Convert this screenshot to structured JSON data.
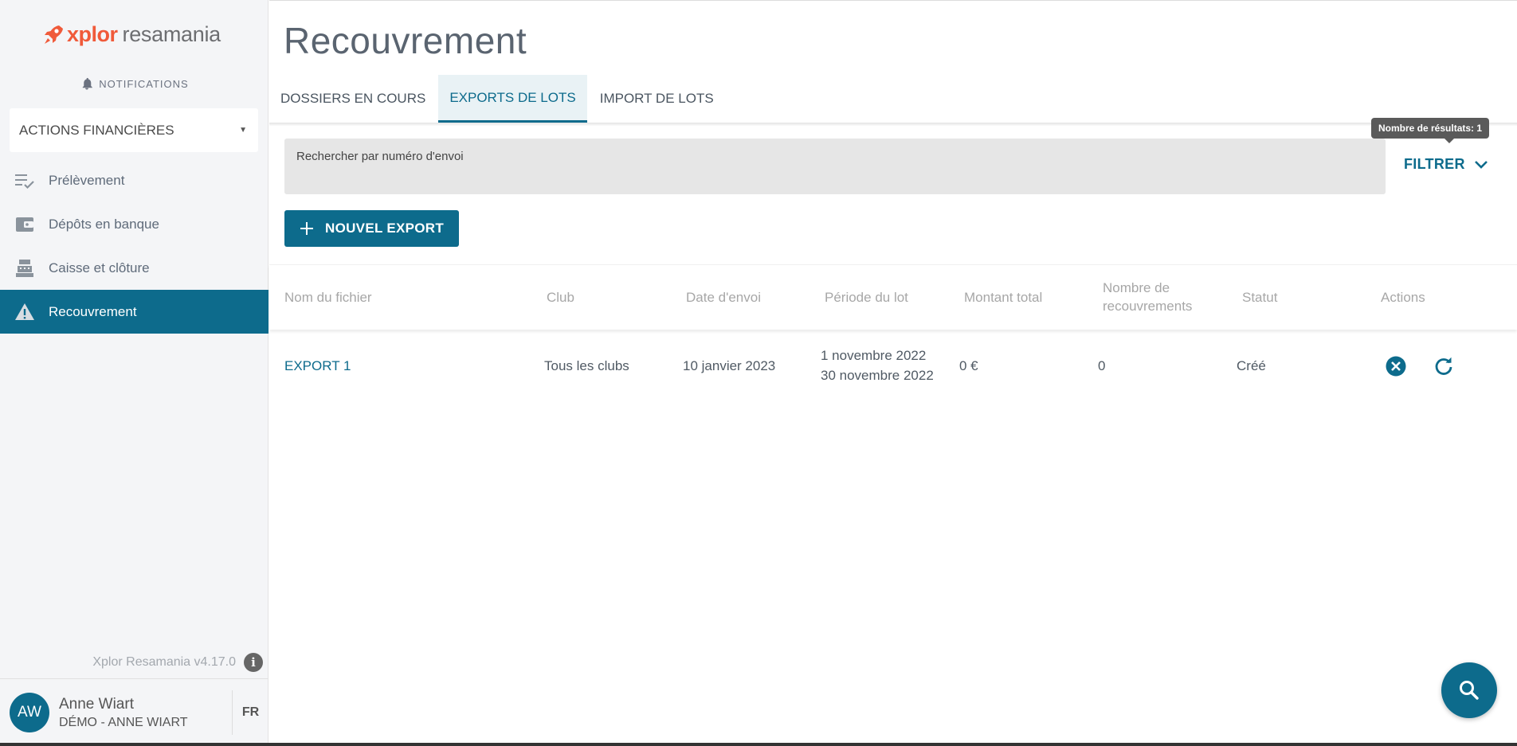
{
  "brand": {
    "part1": "xplor",
    "part2": "resamania",
    "accent": "#f05a3a",
    "primary": "#0d6b8c"
  },
  "sidebar": {
    "notifications": "NOTIFICATIONS",
    "section_select": "ACTIONS FINANCIÈRES",
    "items": [
      {
        "label": "Prélèvement",
        "icon": "checklist-icon"
      },
      {
        "label": "Dépôts en banque",
        "icon": "wallet-icon"
      },
      {
        "label": "Caisse et clôture",
        "icon": "cash-register-icon"
      },
      {
        "label": "Recouvrement",
        "icon": "warning-icon",
        "active": true
      }
    ],
    "version": "Xplor Resamania v4.17.0",
    "user": {
      "initials": "AW",
      "name": "Anne Wiart",
      "org": "DÉMO - ANNE WIART",
      "lang": "FR"
    }
  },
  "main": {
    "title": "Recouvrement",
    "tabs": [
      {
        "label": "DOSSIERS EN COURS"
      },
      {
        "label": "EXPORTS DE LOTS",
        "active": true
      },
      {
        "label": "IMPORT DE LOTS"
      }
    ],
    "search_placeholder": "Rechercher par numéro d'envoi",
    "results_tooltip": "Nombre de résultats: 1",
    "filter_label": "FILTRER",
    "new_export_label": "NOUVEL EXPORT",
    "table": {
      "headers": [
        "Nom du fichier",
        "Club",
        "Date d'envoi",
        "Période du lot",
        "Montant total",
        "Nombre de recouvrements",
        "Statut",
        "Actions"
      ],
      "headers_split": {
        "count_line1": "Nombre de",
        "count_line2": "recouvrements"
      },
      "rows": [
        {
          "file": "EXPORT 1",
          "club": "Tous les clubs",
          "date": "10 janvier 2023",
          "period_start": "1 novembre 2022",
          "period_end": "30 novembre 2022",
          "amount": "0 €",
          "count": "0",
          "status": "Créé"
        }
      ]
    }
  }
}
